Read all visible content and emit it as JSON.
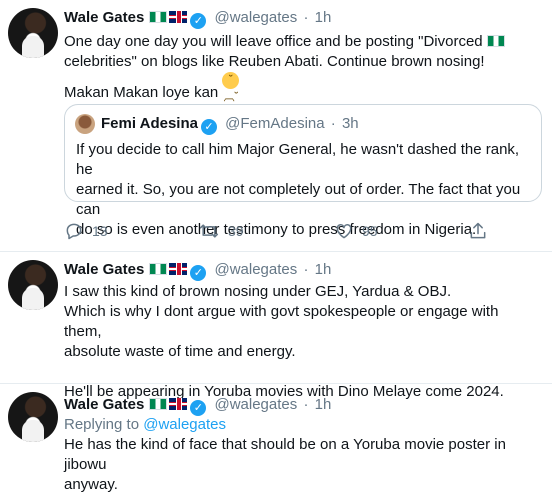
{
  "tweets": [
    {
      "name": "Wale Gates",
      "handle": "@walegates",
      "time": "1h",
      "text_line1": "One day one day you will leave office and be posting \"Divorced",
      "text_line2": "celebrities\" on blogs like Reuben Abati. Continue brown nosing!",
      "text_line3": "Makan Makan loye kan",
      "quote": {
        "name": "Femi Adesina",
        "handle": "@FemAdesina",
        "time": "3h",
        "line1": "If you decide to call him Major General, he wasn't dashed the rank, he",
        "line2": "earned it. So, you are not completely out of order. The fact that you can",
        "line3": "do so is even another testimony to press freedom in Nigeria."
      },
      "replies": "13",
      "retweets": "39",
      "likes": "95"
    },
    {
      "name": "Wale Gates",
      "handle": "@walegates",
      "time": "1h",
      "line1": "I saw this kind of brown nosing under GEJ, Yardua & OBJ.",
      "line2": "Which is why I dont argue with govt spokespeople or engage with them,",
      "line3": "absolute waste of time and energy.",
      "line4": "He'll be appearing in Yoruba movies with Dino Melaye come 2024."
    },
    {
      "name": "Wale Gates",
      "handle": "@walegates",
      "time": "1h",
      "replying_prefix": "Replying to",
      "replying_to": "@walegates",
      "line1": "He has the kind of face that should be on a Yoruba movie poster in jibowu",
      "line2": "anyway."
    }
  ],
  "separator": "·",
  "verified_mark": "✓",
  "emoji_face": "˘︹˘",
  "icons": [
    "reply-icon",
    "retweet-icon",
    "like-icon",
    "share-icon",
    "verified-icon"
  ],
  "colors": {
    "accent": "#1da1f2",
    "muted": "#657786",
    "border": "#e6ecf0"
  }
}
